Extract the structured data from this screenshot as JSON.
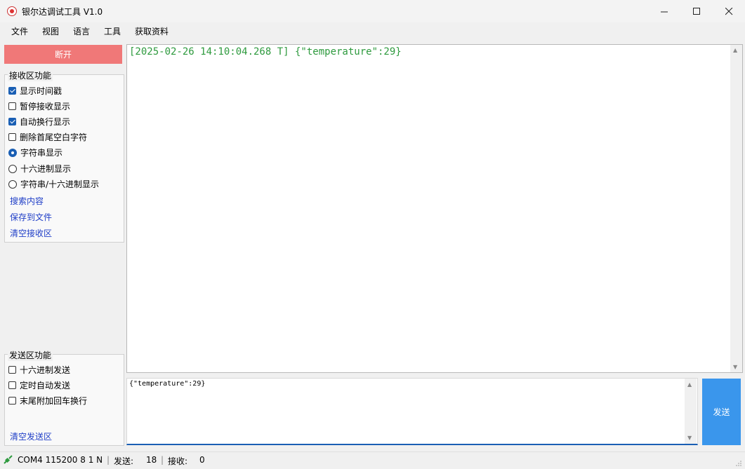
{
  "window": {
    "title": "银尔达调试工具 V1.0",
    "minimize_icon": "minimize-icon",
    "maximize_icon": "maximize-icon",
    "close_icon": "close-icon"
  },
  "menu": {
    "items": [
      "文件",
      "视图",
      "语言",
      "工具",
      "获取资料"
    ]
  },
  "left_panel": {
    "disconnect_label": "断开",
    "disconnect_color": "#f07878",
    "receive_group": {
      "title": "接收区功能",
      "checkboxes": [
        {
          "label": "显示时间戳",
          "checked": true
        },
        {
          "label": "暂停接收显示",
          "checked": false
        },
        {
          "label": "自动换行显示",
          "checked": true
        },
        {
          "label": "删除首尾空白字符",
          "checked": false
        }
      ],
      "radios": [
        {
          "label": "字符串显示",
          "checked": true
        },
        {
          "label": "十六进制显示",
          "checked": false
        },
        {
          "label": "字符串/十六进制显示",
          "checked": false
        }
      ],
      "links": [
        "搜索内容",
        "保存到文件",
        "清空接收区"
      ]
    },
    "send_group": {
      "title": "发送区功能",
      "checkboxes": [
        {
          "label": "十六进制发送",
          "checked": false
        },
        {
          "label": "定时自动发送",
          "checked": false
        },
        {
          "label": "末尾附加回车换行",
          "checked": false
        }
      ],
      "link": "清空发送区"
    }
  },
  "receive_area": {
    "text": "[2025-02-26 14:10:04.268 T] {\"temperature\":29}",
    "text_color": "#2e9a3e"
  },
  "send_area": {
    "text": "{\"temperature\":29}",
    "send_label": "发送",
    "send_color": "#3a96ec"
  },
  "status_bar": {
    "port_info": "COM4 115200 8 1 N",
    "sent_label": "发送:",
    "sent_count": "18",
    "recv_label": "接收:",
    "recv_count": "0",
    "icon": "connection-icon"
  }
}
